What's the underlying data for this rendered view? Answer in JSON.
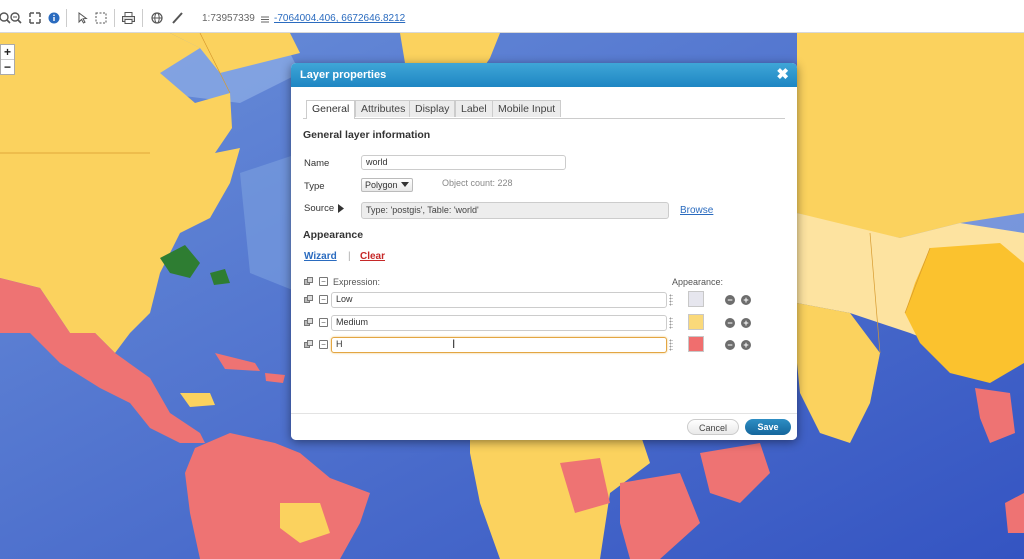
{
  "toolbar": {
    "scale": "1:73957339",
    "coordinates": "-7064004.406, 6672646.8212",
    "icons": [
      "zoom-in-icon",
      "zoom-out-icon",
      "fullscreen-icon",
      "info-icon",
      "select-pointer-icon",
      "select-box-icon",
      "print-icon",
      "globe-icon",
      "draw-icon",
      "coordinates-icon"
    ]
  },
  "zoom": {
    "plus": "+",
    "minus": "−"
  },
  "dialog": {
    "title": "Layer properties",
    "close": "✖",
    "tabs": [
      "General",
      "Attributes",
      "Display",
      "Label",
      "Mobile Input"
    ],
    "general_title": "General layer information",
    "name_label": "Name",
    "name_value": "world",
    "type_label": "Type",
    "type_value": "Polygon",
    "object_count": "Object count: 228",
    "source_label": "Source",
    "source_value": "Type: 'postgis', Table: 'world'",
    "browse": "Browse",
    "appearance_title": "Appearance",
    "wizard": "Wizard",
    "separator": "|",
    "clear": "Clear",
    "expression_header": "Expression:",
    "appearance_header": "Appearance:",
    "rows": [
      {
        "expression": "Low",
        "color": "#e6e6ee"
      },
      {
        "expression": "Medium",
        "color": "#fad97a"
      },
      {
        "expression": "H",
        "color": "#f06e6e"
      }
    ],
    "cancel": "Cancel",
    "save": "Save"
  },
  "colors": {
    "ocean": "#3e63c6",
    "land_low": "#fbd25e",
    "land_high": "#ee7373",
    "header": "#2691cd"
  }
}
